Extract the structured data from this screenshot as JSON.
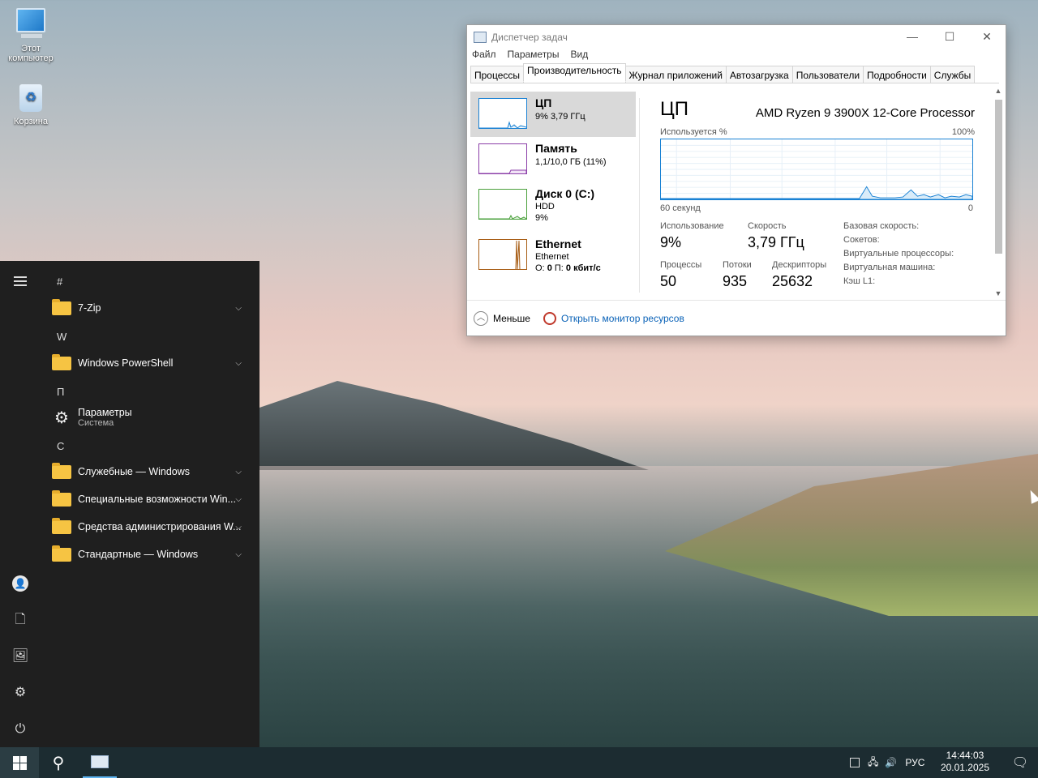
{
  "desktop": {
    "icons": [
      {
        "label_line1": "Этот",
        "label_line2": "компьютер",
        "icon": "this-pc-icon"
      },
      {
        "label": "Корзина",
        "icon": "recycle-bin-icon"
      }
    ]
  },
  "start_menu": {
    "letters": {
      "hash": "#",
      "w": "W",
      "p": "П",
      "c": "С"
    },
    "apps": [
      {
        "label": "7-Zip",
        "icon": "folder-icon",
        "expandable": true
      },
      {
        "label": "Windows PowerShell",
        "icon": "folder-icon",
        "expandable": true
      },
      {
        "label": "Параметры",
        "sub": "Система",
        "icon": "gear-icon"
      },
      {
        "label": "Служебные — Windows",
        "icon": "folder-icon",
        "expandable": true
      },
      {
        "label": "Специальные возможности Win...",
        "icon": "folder-icon",
        "expandable": true
      },
      {
        "label": "Средства администрирования W...",
        "icon": "folder-icon",
        "expandable": true
      },
      {
        "label": "Стандартные — Windows",
        "icon": "folder-icon",
        "expandable": true
      }
    ]
  },
  "task_manager": {
    "title": "Диспетчер задач",
    "menu": [
      "Файл",
      "Параметры",
      "Вид"
    ],
    "tabs": [
      "Процессы",
      "Производительность",
      "Журнал приложений",
      "Автозагрузка",
      "Пользователи",
      "Подробности",
      "Службы"
    ],
    "active_tab": "Производительность",
    "sidebar": {
      "cpu": {
        "name": "ЦП",
        "value": "9%  3,79 ГГц",
        "color": "#1a82d4"
      },
      "memory": {
        "name": "Память",
        "value": "1,1/10,0 ГБ (11%)",
        "color": "#8b3ea8"
      },
      "disk": {
        "name": "Диск 0 (C:)",
        "type": "HDD",
        "value": "9%",
        "color": "#4aa03c"
      },
      "ethernet": {
        "name": "Ethernet",
        "adapter": "Ethernet",
        "value_prefix": "О:",
        "send": "0",
        "value_mid": "П:",
        "receive": "0 кбит/с",
        "color": "#a75c13"
      }
    },
    "detail": {
      "heading": "ЦП",
      "processor": "AMD Ryzen 9 3900X 12-Core Processor",
      "usage_label": "Используется %",
      "max_label": "100%",
      "time_label": "60 секунд",
      "zero_label": "0",
      "stats": {
        "usage": {
          "label": "Использование",
          "value": "9%"
        },
        "speed": {
          "label": "Скорость",
          "value": "3,79 ГГц"
        },
        "processes": {
          "label": "Процессы",
          "value": "50"
        },
        "threads": {
          "label": "Потоки",
          "value": "935"
        },
        "handles": {
          "label": "Дескрипторы",
          "value": "25632"
        }
      },
      "info_labels": [
        "Базовая скорость:",
        "Сокетов:",
        "Виртуальные процессоры:",
        "Виртуальная машина:",
        "Кэш L1:"
      ]
    },
    "footer": {
      "less": "Меньше",
      "monitor": "Открыть монитор ресурсов"
    }
  },
  "taskbar": {
    "language": "РУС",
    "time": "14:44:03",
    "date": "20.01.2025"
  }
}
